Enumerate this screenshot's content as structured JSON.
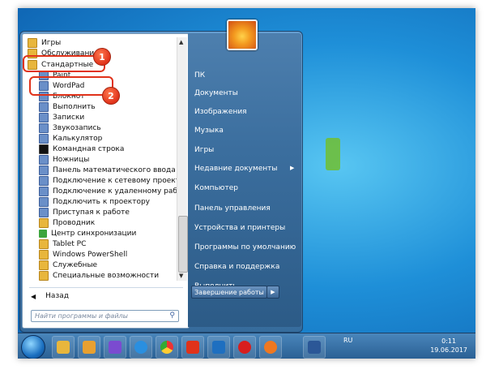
{
  "programs": [
    {
      "label": "Игры",
      "icon": "folder-icon"
    },
    {
      "label": "Обслуживание",
      "icon": "folder-icon"
    },
    {
      "label": "Стандартные",
      "icon": "folder-icon"
    },
    {
      "label": "Paint",
      "icon": "paint-icon"
    },
    {
      "label": "WordPad",
      "icon": "wordpad-icon"
    },
    {
      "label": "Блокнот",
      "icon": "notepad-icon"
    },
    {
      "label": "Выполнить",
      "icon": "run-icon"
    },
    {
      "label": "Записки",
      "icon": "sticky-notes-icon"
    },
    {
      "label": "Звукозапись",
      "icon": "microphone-icon"
    },
    {
      "label": "Калькулятор",
      "icon": "calculator-icon"
    },
    {
      "label": "Командная строка",
      "icon": "cmd-icon"
    },
    {
      "label": "Ножницы",
      "icon": "scissors-icon"
    },
    {
      "label": "Панель математического ввода",
      "icon": "math-input-icon"
    },
    {
      "label": "Подключение к сетевому проектору",
      "icon": "projector-icon"
    },
    {
      "label": "Подключение к удаленному рабочему стол",
      "icon": "remote-desktop-icon"
    },
    {
      "label": "Подключить к проектору",
      "icon": "projector-icon"
    },
    {
      "label": "Приступая к работе",
      "icon": "getting-started-icon"
    },
    {
      "label": "Проводник",
      "icon": "folder-icon"
    },
    {
      "label": "Центр синхронизации",
      "icon": "sync-center-icon"
    },
    {
      "label": "Tablet PC",
      "icon": "folder-icon"
    },
    {
      "label": "Windows PowerShell",
      "icon": "folder-icon"
    },
    {
      "label": "Служебные",
      "icon": "folder-icon"
    },
    {
      "label": "Специальные возможности",
      "icon": "folder-icon"
    }
  ],
  "back_label": "Назад",
  "search_placeholder": "Найти программы и файлы",
  "right_items": [
    "ПК",
    "Документы",
    "Изображения",
    "Музыка",
    "Игры",
    "Недавние документы",
    "Компьютер",
    "Панель управления",
    "Устройства и принтеры",
    "Программы по умолчанию",
    "Справка и поддержка",
    "Выполнить..."
  ],
  "shutdown_label": "Завершение работы",
  "badges": [
    "1",
    "2"
  ],
  "tray": {
    "lang": "RU",
    "time": "0:11",
    "date": "19.06.2017"
  },
  "colors": {
    "highlight": "#e0321a",
    "taskbar": "#2a5f93"
  }
}
